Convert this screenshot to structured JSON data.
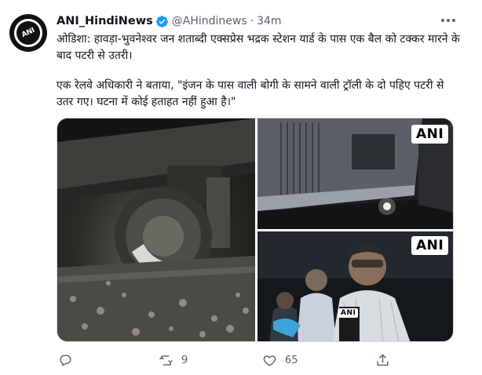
{
  "tweet": {
    "display_name": "ANI_HindiNews",
    "handle": "@AHindinews",
    "separator": "·",
    "time": "34m",
    "avatar_text": "ANI",
    "paragraph1": "ओडिशा: हावड़ा-भुवनेश्वर जन शताब्दी एक्सप्रेस भद्रक स्टेशन यार्ड के पास एक बैल को टक्कर मारने के बाद पटरी से उतरी।",
    "paragraph2": "एक रेलवे अधिकारी ने बताया, \"इंजन के पास वाली बोगी के सामने वाली ट्रॉली के दो पहिए पटरी से उतर गए। घटना में कोई हताहत नहीं हुआ है।\"",
    "media": {
      "watermark1": "ANI",
      "watermark2": "ANI",
      "mic_label": "ANI"
    },
    "actions": {
      "replies": "",
      "retweets": "9",
      "likes": "65"
    }
  },
  "colors": {
    "verified": "#1d9bf0",
    "secondary_text": "#536471",
    "primary_text": "#0f1419"
  },
  "icons": [
    "verified-badge-icon",
    "more-icon",
    "reply-icon",
    "retweet-icon",
    "like-icon",
    "share-icon"
  ]
}
